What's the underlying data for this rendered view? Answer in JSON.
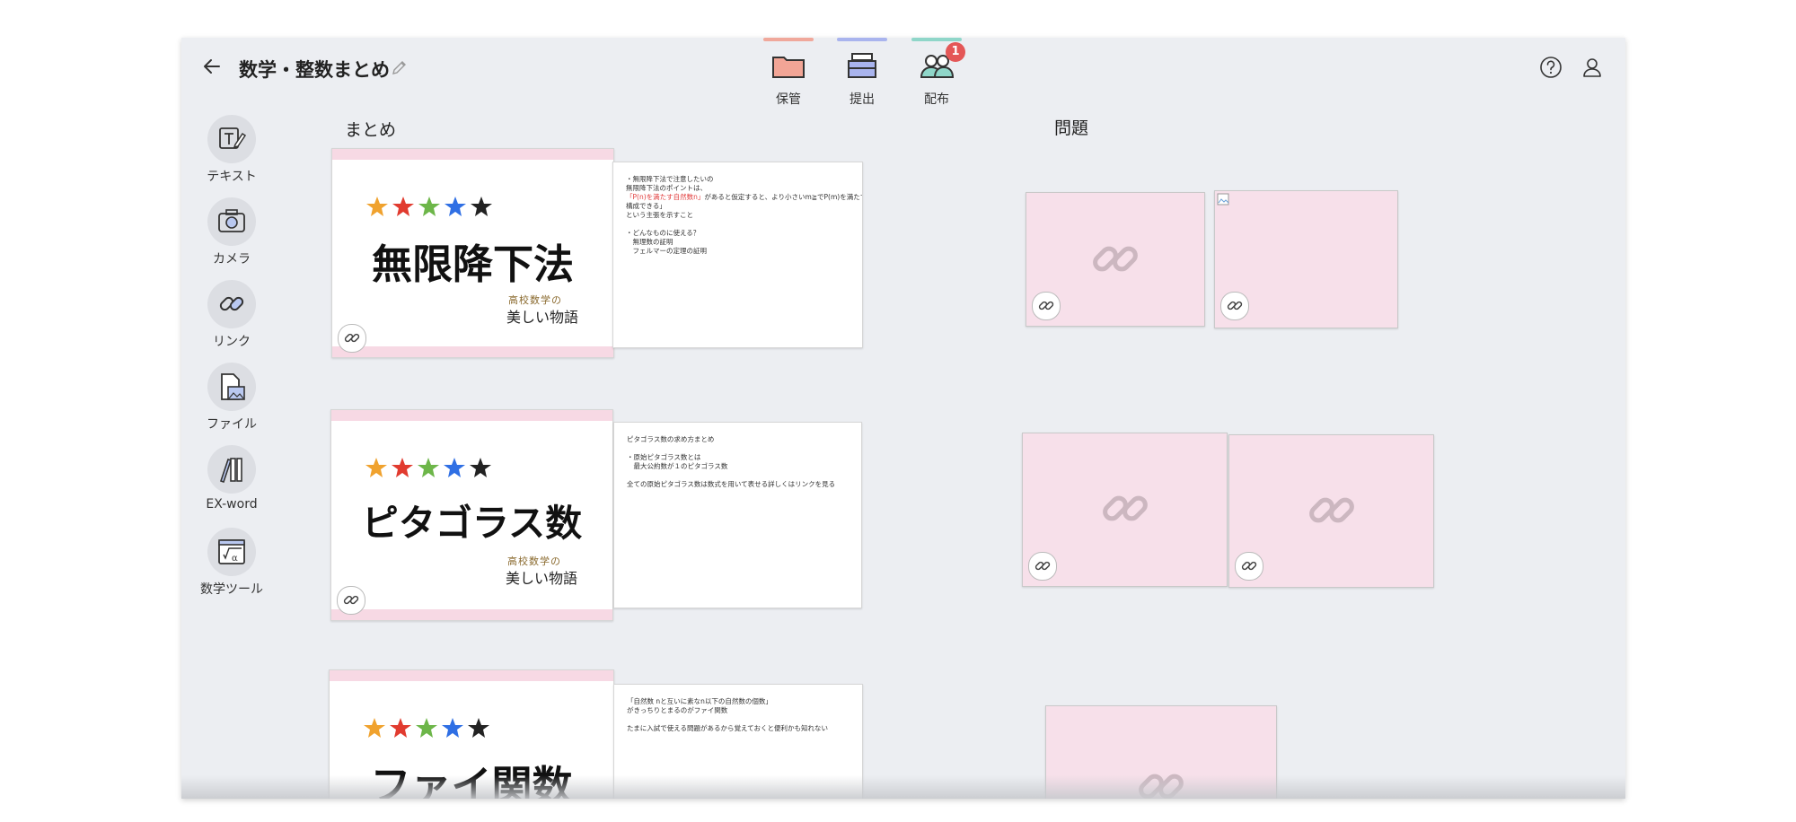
{
  "header": {
    "title": "数学・整数まとめ",
    "toolbar": [
      {
        "label": "保管",
        "color": "#f0a89b"
      },
      {
        "label": "提出",
        "color": "#a9b4ee"
      },
      {
        "label": "配布",
        "color": "#8fd6c9",
        "badge": "1"
      }
    ]
  },
  "tools": [
    {
      "label": "テキスト",
      "icon": "text-icon"
    },
    {
      "label": "カメラ",
      "icon": "camera-icon"
    },
    {
      "label": "リンク",
      "icon": "link-icon"
    },
    {
      "label": "ファイル",
      "icon": "file-icon"
    },
    {
      "label": "EX-word",
      "icon": "books-icon"
    },
    {
      "label": "数学ツール",
      "icon": "math-tool-icon"
    }
  ],
  "sections": {
    "summary_label": "まとめ",
    "problem_label": "問題"
  },
  "summary_cards": [
    {
      "title": "無限降下法",
      "sub_small": "高校数学の",
      "sub_big": "美しい物語"
    },
    {
      "title": "ピタゴラス数",
      "sub_small": "高校数学の",
      "sub_big": "美しい物語"
    },
    {
      "title": "ファイ関数"
    }
  ],
  "notes": [
    {
      "lines": [
        {
          "text": "・無限降下法で注意したいの"
        },
        {
          "text": "無限降下法のポイントは、"
        },
        {
          "red": "「P(n)を満たす自然数n」",
          "text": "があると仮定すると、より小さいm≧でP(m)を満たすものが"
        },
        {
          "text": "構成できる」"
        },
        {
          "text": "という主張を示すこと"
        },
        {
          "text": ""
        },
        {
          "text": "・どんなものに使える？"
        },
        {
          "text": "　無理数の証明"
        },
        {
          "text": "　フェルマーの定理の証明"
        }
      ]
    },
    {
      "lines": [
        {
          "text": "ピタゴラス数の求め方まとめ"
        },
        {
          "text": ""
        },
        {
          "text": "・原始ピタゴラス数とは"
        },
        {
          "text": "　最大公約数が１のピタゴラス数"
        },
        {
          "text": ""
        },
        {
          "text": "全ての原始ピタゴラス数は数式を用いて表せる詳しくはリンクを見る"
        }
      ]
    },
    {
      "lines": [
        {
          "text": "「自然数 nと互いに素なn以下の自然数の個数」"
        },
        {
          "text": "がきっちりとまるのがファイ関数"
        },
        {
          "text": ""
        },
        {
          "text": "たまに入試で使える問題があるから覚えておくと便利かも知れない"
        }
      ]
    }
  ]
}
